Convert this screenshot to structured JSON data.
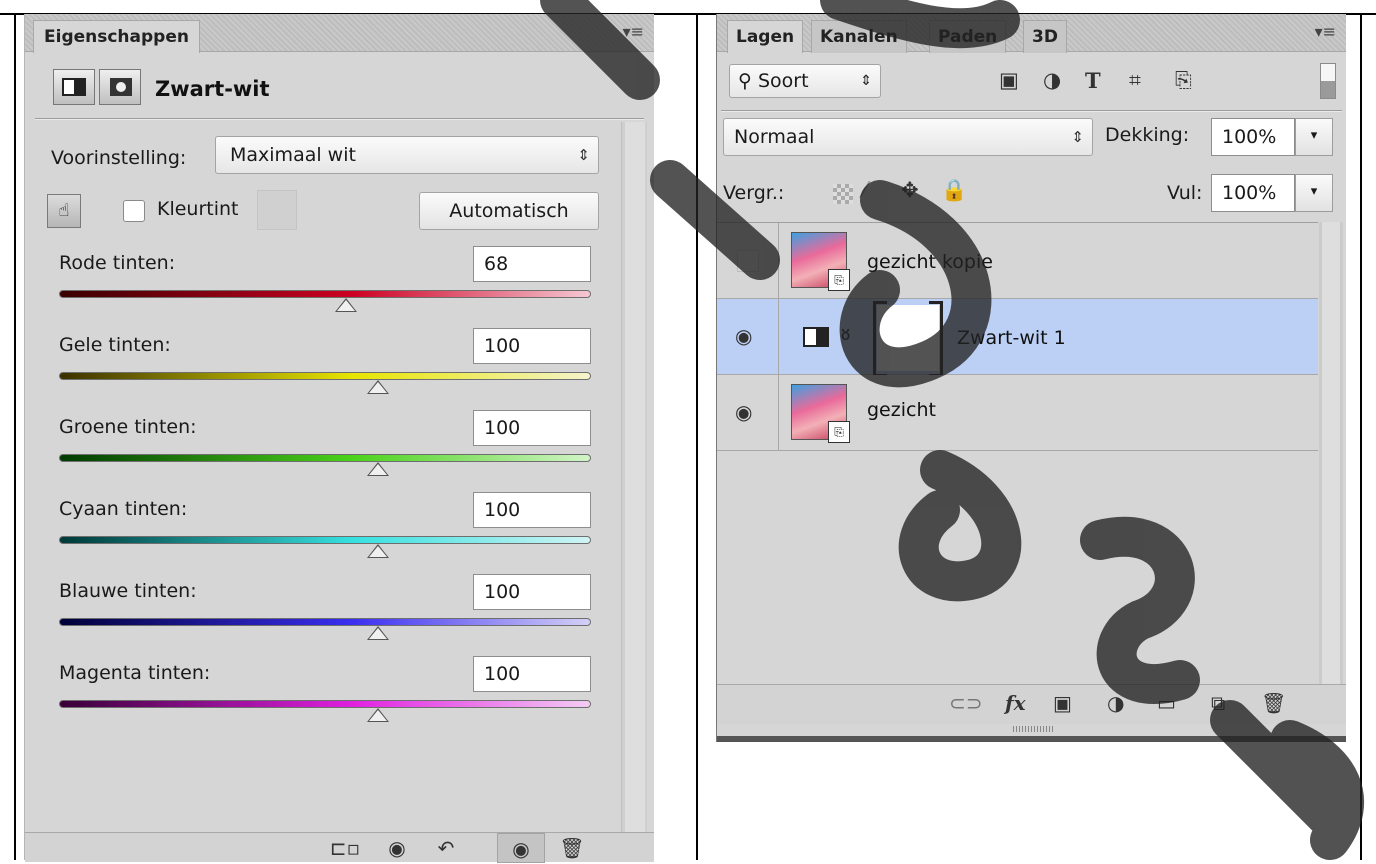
{
  "properties_panel": {
    "tab_label": "Eigenschappen",
    "menu_icon": "panel-menu-icon",
    "title": "Zwart-wit",
    "preset_label": "Voorinstelling:",
    "preset_value": "Maximaal wit",
    "tint_label": "Kleurtint",
    "auto_button": "Automatisch",
    "sliders": [
      {
        "label": "Rode tinten:",
        "value": "68",
        "percent": 0.54,
        "colors": [
          "#3a0000",
          "#cc0022",
          "#f6c8d4"
        ]
      },
      {
        "label": "Gele tinten:",
        "value": "100",
        "percent": 0.6,
        "colors": [
          "#3a3000",
          "#e8e400",
          "#f4f4cc"
        ]
      },
      {
        "label": "Groene tinten:",
        "value": "100",
        "percent": 0.6,
        "colors": [
          "#003a00",
          "#4ad21a",
          "#d2f4c8"
        ]
      },
      {
        "label": "Cyaan tinten:",
        "value": "100",
        "percent": 0.6,
        "colors": [
          "#003838",
          "#36e0e0",
          "#d0f4f4"
        ]
      },
      {
        "label": "Blauwe tinten:",
        "value": "100",
        "percent": 0.6,
        "colors": [
          "#000038",
          "#3a2ef0",
          "#d4d0f6"
        ]
      },
      {
        "label": "Magenta tinten:",
        "value": "100",
        "percent": 0.6,
        "colors": [
          "#380038",
          "#e020e0",
          "#f4ccf4"
        ]
      }
    ],
    "footer_icons": [
      "clip-to-layer-icon",
      "view-previous-state-icon",
      "reset-icon",
      "visibility-icon",
      "trash-icon"
    ]
  },
  "layers_panel": {
    "tabs": [
      "Lagen",
      "Kanalen",
      "Paden",
      "3D"
    ],
    "filter_label": "Soort",
    "blend_mode": "Normaal",
    "opacity_label": "Dekking:",
    "opacity_value": "100%",
    "lock_label": "Vergr.:",
    "fill_label": "Vul:",
    "fill_value": "100%",
    "layers": [
      {
        "name": "gezicht kopie",
        "visible": false,
        "type": "smart-object"
      },
      {
        "name": "Zwart-wit 1",
        "visible": true,
        "type": "adjustment",
        "selected": true
      },
      {
        "name": "gezicht",
        "visible": true,
        "type": "smart-object"
      }
    ]
  }
}
